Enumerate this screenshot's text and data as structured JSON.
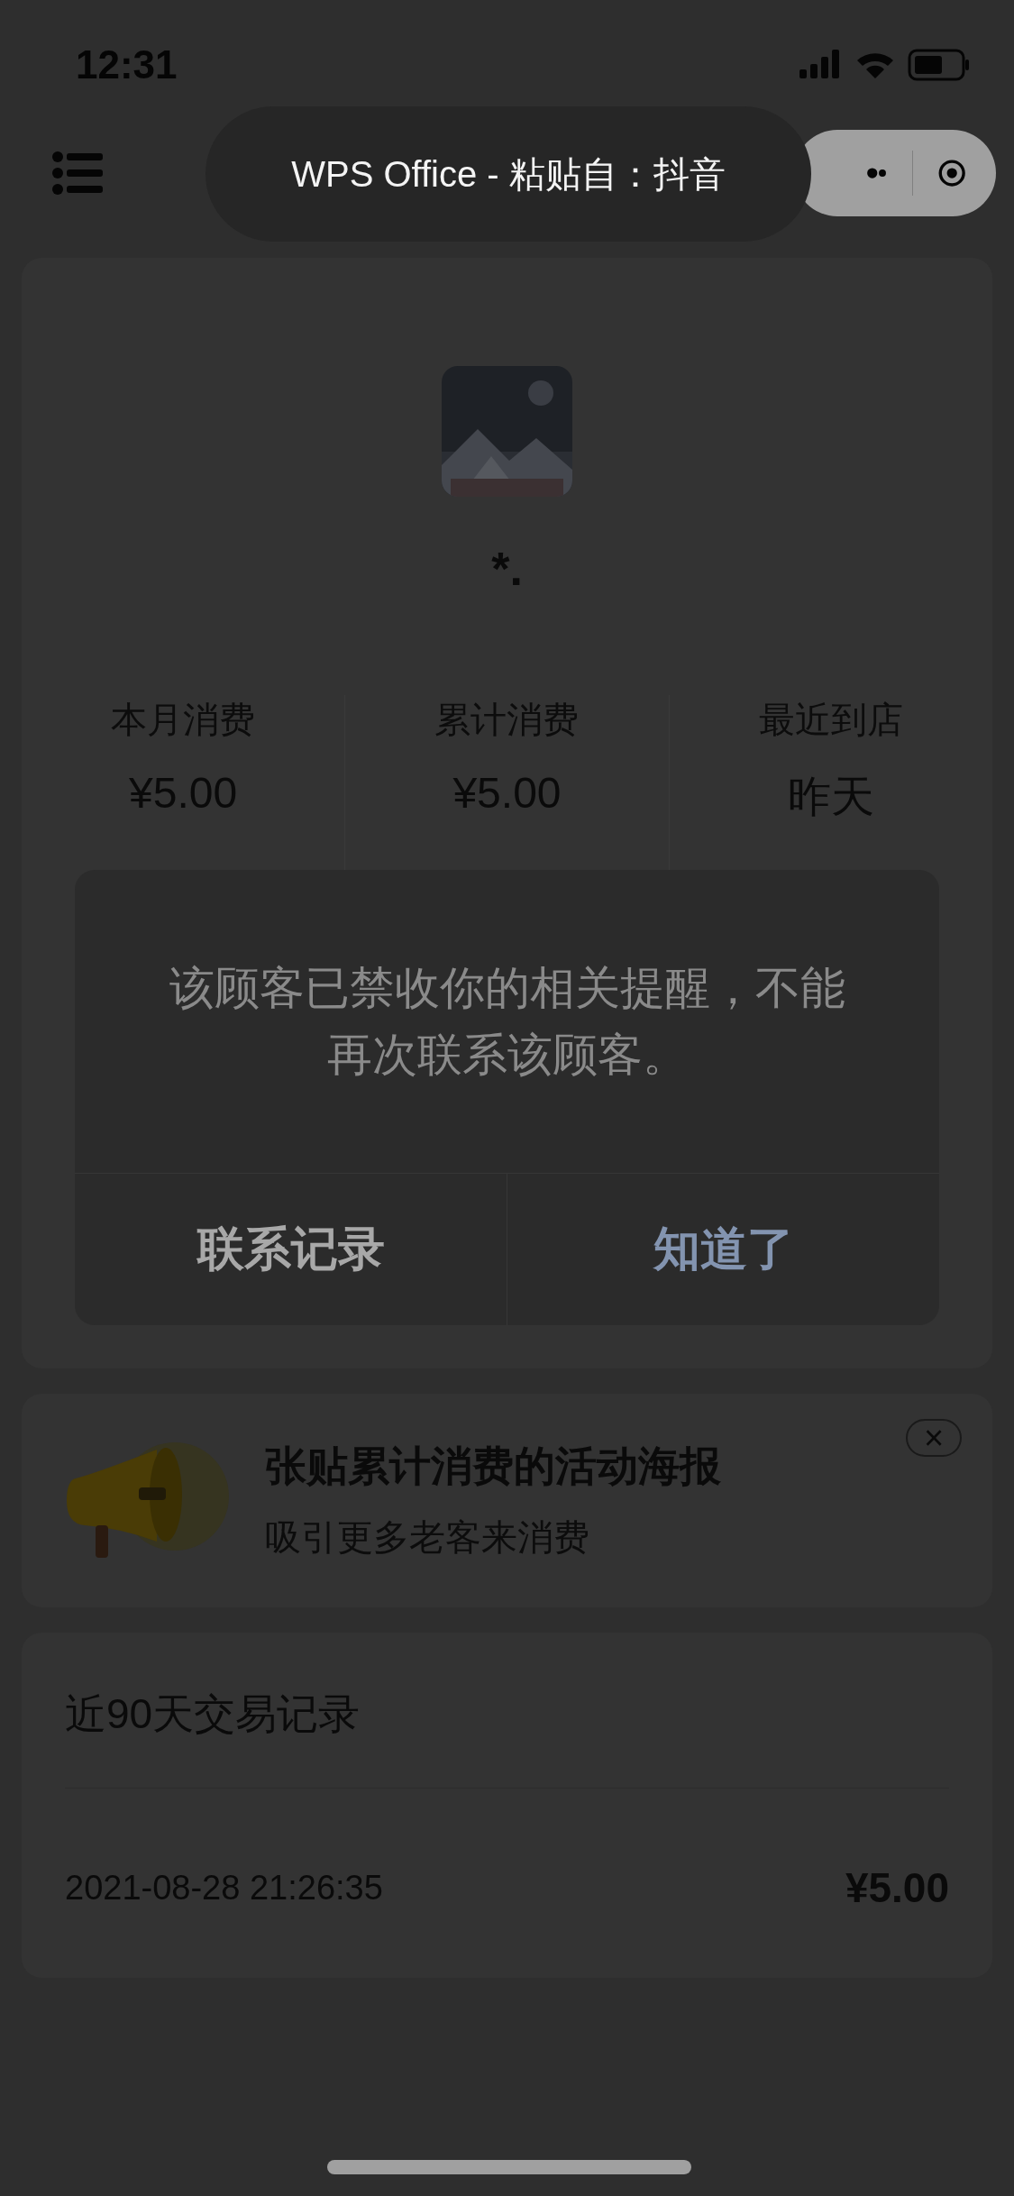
{
  "status_bar": {
    "time": "12:31"
  },
  "nav": {
    "title": "WPS Office - 粘贴自：抖音"
  },
  "profile": {
    "name": "*."
  },
  "stats": [
    {
      "label": "本月消费",
      "value": "¥5.00"
    },
    {
      "label": "累计消费",
      "value": "¥5.00"
    },
    {
      "label": "最近到店",
      "value": "昨天"
    }
  ],
  "dialog": {
    "message": "该顾客已禁收你的相关提醒，不能再次联系该顾客。",
    "buttons": [
      {
        "label": "联系记录",
        "kind": "secondary"
      },
      {
        "label": "知道了",
        "kind": "primary"
      }
    ]
  },
  "promo": {
    "title": "张贴累计消费的活动海报",
    "subtitle": "吸引更多老客来消费",
    "close": "×"
  },
  "records": {
    "title": "近90天交易记录",
    "rows": [
      {
        "time": "2021-08-28 21:26:35",
        "amount": "¥5.00"
      }
    ]
  }
}
